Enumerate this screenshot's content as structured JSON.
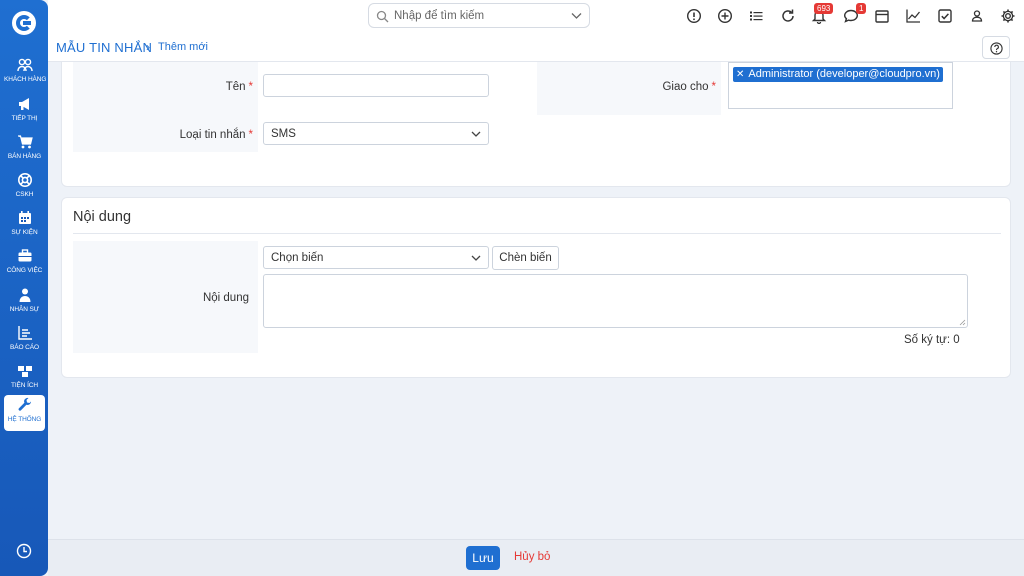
{
  "sidebar": {
    "items": [
      {
        "label": "KHÁCH HÀNG",
        "icon": "users-icon"
      },
      {
        "label": "TIẾP THỊ",
        "icon": "megaphone-icon"
      },
      {
        "label": "BÁN HÀNG",
        "icon": "cart-icon"
      },
      {
        "label": "CSKH",
        "icon": "lifebuoy-icon"
      },
      {
        "label": "SỰ KIỆN",
        "icon": "calendar-icon"
      },
      {
        "label": "CÔNG VIỆC",
        "icon": "briefcase-icon"
      },
      {
        "label": "NHÂN SỰ",
        "icon": "person-icon"
      },
      {
        "label": "BÁO CÁO",
        "icon": "report-icon"
      },
      {
        "label": "TIỆN ÍCH",
        "icon": "cubes-icon"
      },
      {
        "label": "HỆ THỐNG",
        "icon": "wrench-icon",
        "active": true
      }
    ]
  },
  "topbar": {
    "search_placeholder": "Nhập để tìm kiếm",
    "notification_count": "693",
    "message_count": "1"
  },
  "breadcrumb": {
    "module": "MẪU TIN NHẮN",
    "separator": "›",
    "current": "Thêm mới"
  },
  "form": {
    "name_label": "Tên",
    "name_value": "",
    "message_type_label": "Loại tin nhắn",
    "message_type_value": "SMS",
    "assign_label": "Giao cho",
    "assign_tag": "Administrator (developer@cloudpro.vn)",
    "required_mark": "*"
  },
  "content_section": {
    "title": "Nội dung",
    "variable_select": "Chọn biến",
    "insert_button": "Chèn biến",
    "content_label": "Nội dung",
    "content_value": "",
    "char_count": "Số ký tự: 0"
  },
  "footer": {
    "save_label": "Lưu",
    "cancel_label": "Hủy bỏ"
  },
  "colors": {
    "primary": "#1f6fd1",
    "danger": "#e53935"
  }
}
